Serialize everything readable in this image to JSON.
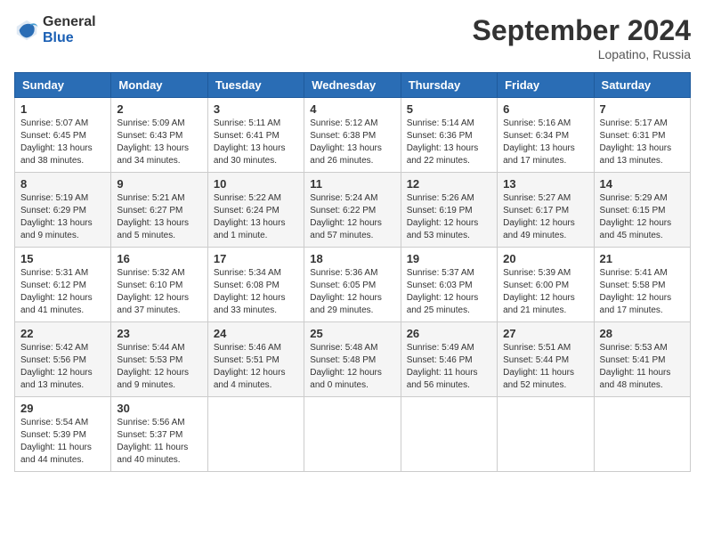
{
  "header": {
    "logo": {
      "general": "General",
      "blue": "Blue"
    },
    "title": "September 2024",
    "location": "Lopatino, Russia"
  },
  "weekdays": [
    "Sunday",
    "Monday",
    "Tuesday",
    "Wednesday",
    "Thursday",
    "Friday",
    "Saturday"
  ],
  "weeks": [
    [
      {
        "day": "1",
        "sunrise": "Sunrise: 5:07 AM",
        "sunset": "Sunset: 6:45 PM",
        "daylight": "Daylight: 13 hours and 38 minutes."
      },
      {
        "day": "2",
        "sunrise": "Sunrise: 5:09 AM",
        "sunset": "Sunset: 6:43 PM",
        "daylight": "Daylight: 13 hours and 34 minutes."
      },
      {
        "day": "3",
        "sunrise": "Sunrise: 5:11 AM",
        "sunset": "Sunset: 6:41 PM",
        "daylight": "Daylight: 13 hours and 30 minutes."
      },
      {
        "day": "4",
        "sunrise": "Sunrise: 5:12 AM",
        "sunset": "Sunset: 6:38 PM",
        "daylight": "Daylight: 13 hours and 26 minutes."
      },
      {
        "day": "5",
        "sunrise": "Sunrise: 5:14 AM",
        "sunset": "Sunset: 6:36 PM",
        "daylight": "Daylight: 13 hours and 22 minutes."
      },
      {
        "day": "6",
        "sunrise": "Sunrise: 5:16 AM",
        "sunset": "Sunset: 6:34 PM",
        "daylight": "Daylight: 13 hours and 17 minutes."
      },
      {
        "day": "7",
        "sunrise": "Sunrise: 5:17 AM",
        "sunset": "Sunset: 6:31 PM",
        "daylight": "Daylight: 13 hours and 13 minutes."
      }
    ],
    [
      {
        "day": "8",
        "sunrise": "Sunrise: 5:19 AM",
        "sunset": "Sunset: 6:29 PM",
        "daylight": "Daylight: 13 hours and 9 minutes."
      },
      {
        "day": "9",
        "sunrise": "Sunrise: 5:21 AM",
        "sunset": "Sunset: 6:27 PM",
        "daylight": "Daylight: 13 hours and 5 minutes."
      },
      {
        "day": "10",
        "sunrise": "Sunrise: 5:22 AM",
        "sunset": "Sunset: 6:24 PM",
        "daylight": "Daylight: 13 hours and 1 minute."
      },
      {
        "day": "11",
        "sunrise": "Sunrise: 5:24 AM",
        "sunset": "Sunset: 6:22 PM",
        "daylight": "Daylight: 12 hours and 57 minutes."
      },
      {
        "day": "12",
        "sunrise": "Sunrise: 5:26 AM",
        "sunset": "Sunset: 6:19 PM",
        "daylight": "Daylight: 12 hours and 53 minutes."
      },
      {
        "day": "13",
        "sunrise": "Sunrise: 5:27 AM",
        "sunset": "Sunset: 6:17 PM",
        "daylight": "Daylight: 12 hours and 49 minutes."
      },
      {
        "day": "14",
        "sunrise": "Sunrise: 5:29 AM",
        "sunset": "Sunset: 6:15 PM",
        "daylight": "Daylight: 12 hours and 45 minutes."
      }
    ],
    [
      {
        "day": "15",
        "sunrise": "Sunrise: 5:31 AM",
        "sunset": "Sunset: 6:12 PM",
        "daylight": "Daylight: 12 hours and 41 minutes."
      },
      {
        "day": "16",
        "sunrise": "Sunrise: 5:32 AM",
        "sunset": "Sunset: 6:10 PM",
        "daylight": "Daylight: 12 hours and 37 minutes."
      },
      {
        "day": "17",
        "sunrise": "Sunrise: 5:34 AM",
        "sunset": "Sunset: 6:08 PM",
        "daylight": "Daylight: 12 hours and 33 minutes."
      },
      {
        "day": "18",
        "sunrise": "Sunrise: 5:36 AM",
        "sunset": "Sunset: 6:05 PM",
        "daylight": "Daylight: 12 hours and 29 minutes."
      },
      {
        "day": "19",
        "sunrise": "Sunrise: 5:37 AM",
        "sunset": "Sunset: 6:03 PM",
        "daylight": "Daylight: 12 hours and 25 minutes."
      },
      {
        "day": "20",
        "sunrise": "Sunrise: 5:39 AM",
        "sunset": "Sunset: 6:00 PM",
        "daylight": "Daylight: 12 hours and 21 minutes."
      },
      {
        "day": "21",
        "sunrise": "Sunrise: 5:41 AM",
        "sunset": "Sunset: 5:58 PM",
        "daylight": "Daylight: 12 hours and 17 minutes."
      }
    ],
    [
      {
        "day": "22",
        "sunrise": "Sunrise: 5:42 AM",
        "sunset": "Sunset: 5:56 PM",
        "daylight": "Daylight: 12 hours and 13 minutes."
      },
      {
        "day": "23",
        "sunrise": "Sunrise: 5:44 AM",
        "sunset": "Sunset: 5:53 PM",
        "daylight": "Daylight: 12 hours and 9 minutes."
      },
      {
        "day": "24",
        "sunrise": "Sunrise: 5:46 AM",
        "sunset": "Sunset: 5:51 PM",
        "daylight": "Daylight: 12 hours and 4 minutes."
      },
      {
        "day": "25",
        "sunrise": "Sunrise: 5:48 AM",
        "sunset": "Sunset: 5:48 PM",
        "daylight": "Daylight: 12 hours and 0 minutes."
      },
      {
        "day": "26",
        "sunrise": "Sunrise: 5:49 AM",
        "sunset": "Sunset: 5:46 PM",
        "daylight": "Daylight: 11 hours and 56 minutes."
      },
      {
        "day": "27",
        "sunrise": "Sunrise: 5:51 AM",
        "sunset": "Sunset: 5:44 PM",
        "daylight": "Daylight: 11 hours and 52 minutes."
      },
      {
        "day": "28",
        "sunrise": "Sunrise: 5:53 AM",
        "sunset": "Sunset: 5:41 PM",
        "daylight": "Daylight: 11 hours and 48 minutes."
      }
    ],
    [
      {
        "day": "29",
        "sunrise": "Sunrise: 5:54 AM",
        "sunset": "Sunset: 5:39 PM",
        "daylight": "Daylight: 11 hours and 44 minutes."
      },
      {
        "day": "30",
        "sunrise": "Sunrise: 5:56 AM",
        "sunset": "Sunset: 5:37 PM",
        "daylight": "Daylight: 11 hours and 40 minutes."
      },
      null,
      null,
      null,
      null,
      null
    ]
  ]
}
